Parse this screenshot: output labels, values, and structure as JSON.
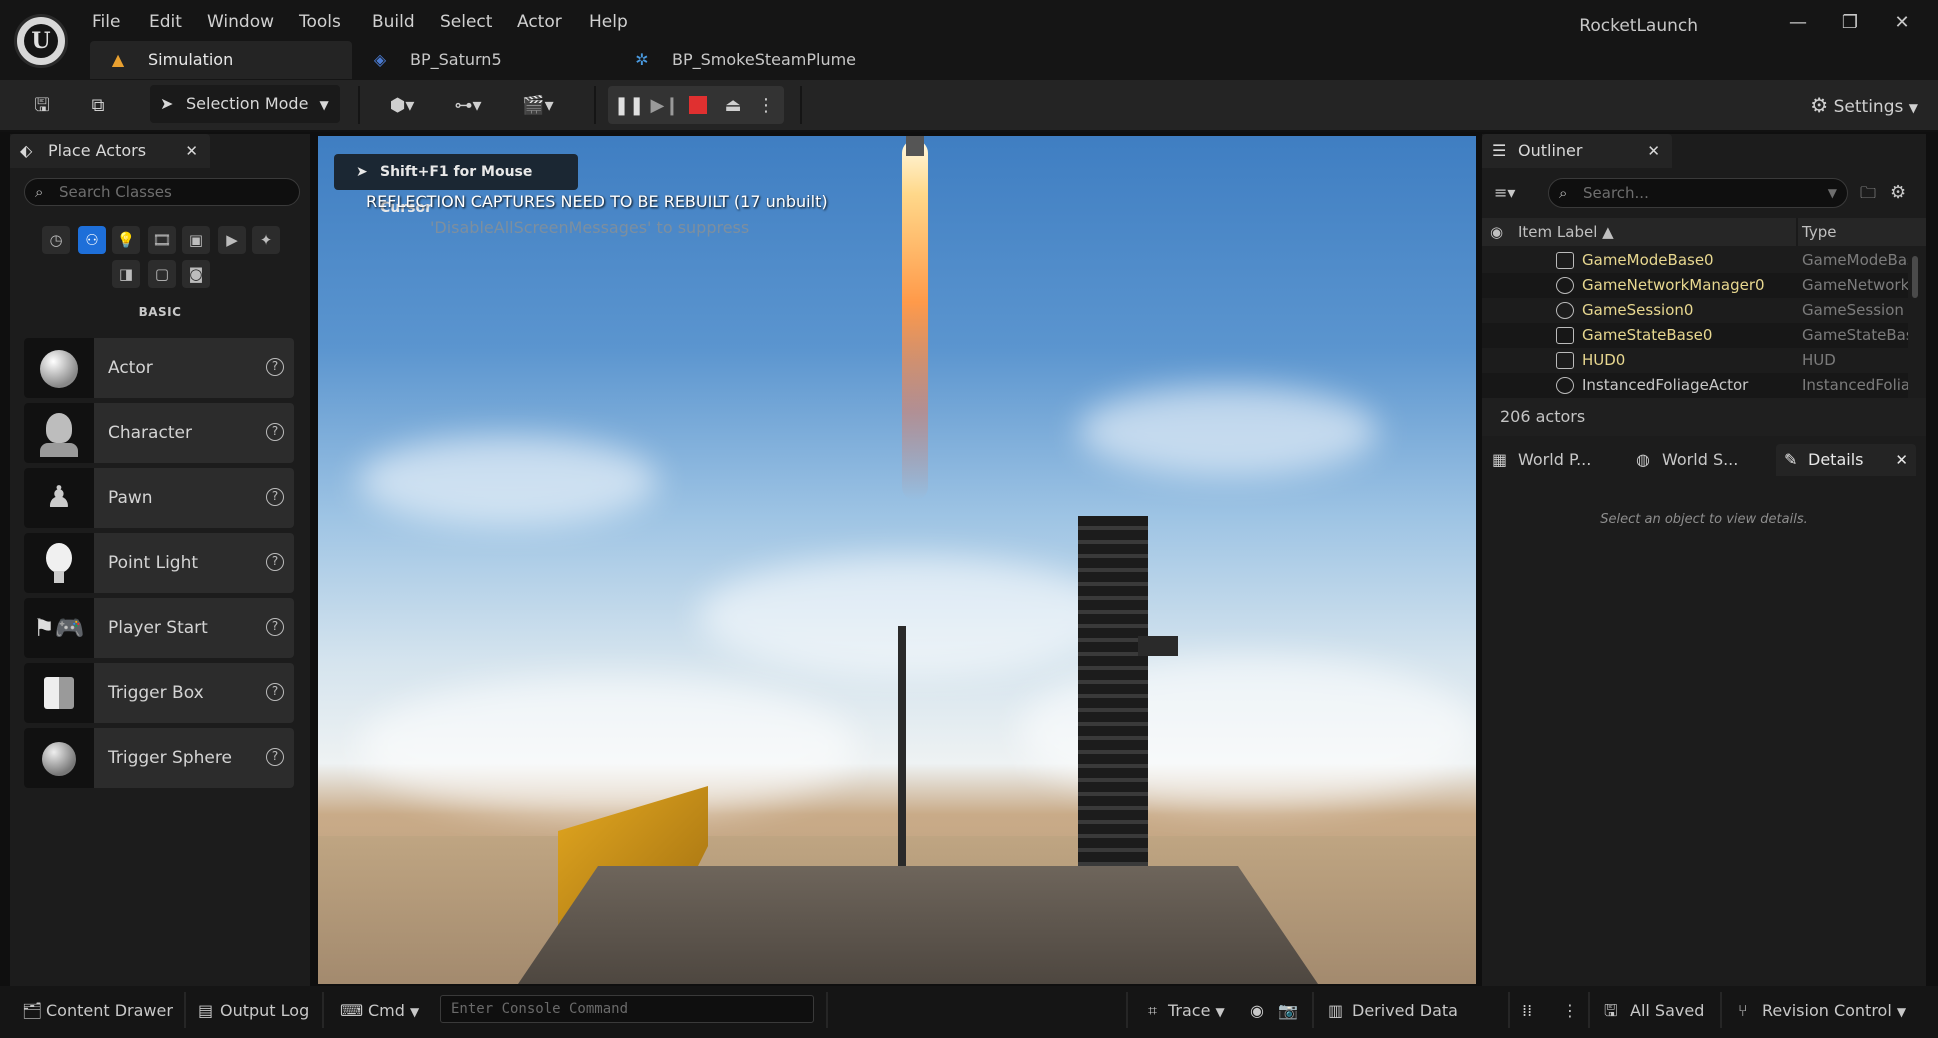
{
  "menu": [
    "File",
    "Edit",
    "Window",
    "Tools",
    "Build",
    "Select",
    "Actor",
    "Help"
  ],
  "app_title": "RocketLaunch",
  "window_controls": {
    "minimize": "—",
    "restore": "❐",
    "close": "✕"
  },
  "doc_tabs": [
    "Simulation",
    "BP_Saturn5",
    "BP_SmokeSteamPlume"
  ],
  "toolbar": {
    "mode_label": "Selection Mode",
    "settings_label": "Settings"
  },
  "place_actors": {
    "tab_label": "Place Actors",
    "search_placeholder": "Search Classes",
    "category_label": "BASIC",
    "items": [
      "Actor",
      "Character",
      "Pawn",
      "Point Light",
      "Player Start",
      "Trigger Box",
      "Trigger Sphere"
    ],
    "help_glyph": "?"
  },
  "viewport": {
    "cursor_hint": "Shift+F1 for Mouse Cursor",
    "reflection_message": "REFLECTION CAPTURES NEED TO BE REBUILT (17 unbuilt)",
    "suppress_message": "'DisableAllScreenMessages' to suppress"
  },
  "outliner": {
    "tab_label": "Outliner",
    "search_placeholder": "Search...",
    "col_label": "Item Label ▲",
    "col_type": "Type",
    "rows": [
      {
        "name": "GameModeBase0",
        "type": "GameModeBase"
      },
      {
        "name": "GameNetworkManager0",
        "type": "GameNetworkManager"
      },
      {
        "name": "GameSession0",
        "type": "GameSession"
      },
      {
        "name": "GameStateBase0",
        "type": "GameStateBase"
      },
      {
        "name": "HUD0",
        "type": "HUD"
      },
      {
        "name": "InstancedFoliageActor",
        "type": "InstancedFoliageActor"
      }
    ],
    "actor_count": "206 actors"
  },
  "details": {
    "tabs": [
      "World P...",
      "World S...",
      "Details"
    ],
    "empty_message": "Select an object to view details."
  },
  "statusbar": {
    "content_drawer": "Content Drawer",
    "output_log": "Output Log",
    "cmd": "Cmd",
    "console_placeholder": "Enter Console Command",
    "trace": "Trace",
    "derived_data": "Derived Data",
    "all_saved": "All Saved",
    "revision_control": "Revision Control"
  },
  "colors": {
    "accent_blue": "#1e6fd9",
    "stop_red": "#e03030",
    "outliner_name": "#e8d890"
  }
}
